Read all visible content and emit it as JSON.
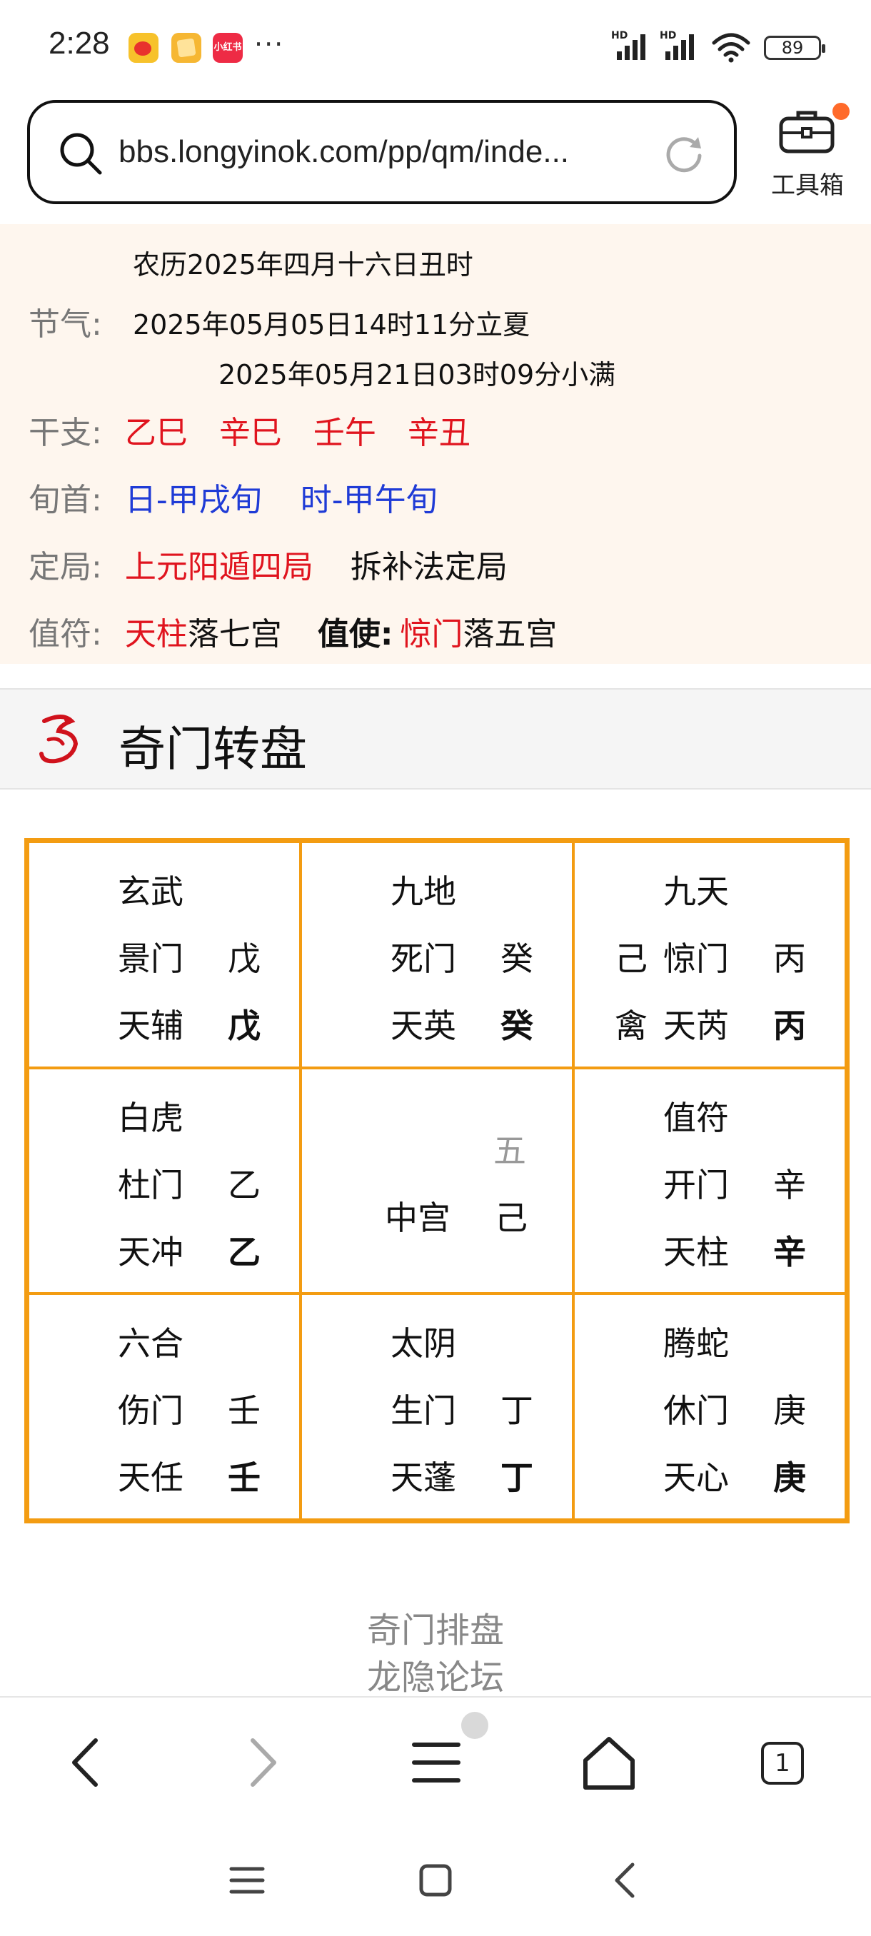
{
  "status_bar": {
    "time": "2:28",
    "xhs_badge": "小红书",
    "more": "···",
    "hd1": "HD",
    "hd2": "HD",
    "battery": "89"
  },
  "address_bar": {
    "url": "bbs.longyinok.com/pp/qm/inde..."
  },
  "toolbox": {
    "label": "工具箱"
  },
  "info": {
    "lunar": "农历2025年四月十六日丑时",
    "jieqi_label": "节气:",
    "jieqi_1": "2025年05月05日14时11分立夏",
    "jieqi_2": "2025年05月21日03时09分小满",
    "ganzhi_label": "干支:",
    "ganzhi": [
      "乙巳",
      "辛巳",
      "壬午",
      "辛丑"
    ],
    "xunshou_label": "旬首:",
    "xunshou": [
      "日-甲戌旬",
      "时-甲午旬"
    ],
    "dingju_label": "定局:",
    "dingju_value": "上元阳遁四局",
    "dingju_method": "拆补法定局",
    "zhifu_label": "值符:",
    "zhifu_star": "天柱",
    "zhifu_palace": "落七宫",
    "zhishi_label": "值使:",
    "zhishi_door": "惊门",
    "zhishi_palace": "落五宫"
  },
  "section": {
    "title": "奇门转盘"
  },
  "chart": {
    "cells": [
      {
        "god": "玄武",
        "door": "景门",
        "door_stem": "戊",
        "star": "天辅",
        "star_stem": "戊"
      },
      {
        "god": "九地",
        "door": "死门",
        "door_stem": "癸",
        "star": "天英",
        "star_stem": "癸"
      },
      {
        "god": "九天",
        "side_1": "己",
        "side_2": "禽",
        "door": "惊门",
        "door_stem": "丙",
        "star": "天芮",
        "star_stem": "丙"
      },
      {
        "god": "白虎",
        "door": "杜门",
        "door_stem": "乙",
        "star": "天冲",
        "star_stem": "乙"
      },
      {
        "center_number": "五",
        "center_label": "中宫",
        "center_stem": "己"
      },
      {
        "god": "值符",
        "door": "开门",
        "door_stem": "辛",
        "star": "天柱",
        "star_stem": "辛"
      },
      {
        "god": "六合",
        "door": "伤门",
        "door_stem": "壬",
        "star": "天任",
        "star_stem": "壬"
      },
      {
        "god": "太阴",
        "door": "生门",
        "door_stem": "丁",
        "star": "天蓬",
        "star_stem": "丁"
      },
      {
        "god": "腾蛇",
        "door": "休门",
        "door_stem": "庚",
        "star": "天心",
        "star_stem": "庚"
      }
    ]
  },
  "footer": {
    "line1": "奇门排盘",
    "line2": "龙隐论坛"
  },
  "browser_toolbar": {
    "tab_count": "1"
  },
  "colors": {
    "accent_orange": "#f39c12",
    "red_text": "#e0141e",
    "blue_text": "#1f3bd6",
    "panel_bg": "#fef6ee"
  }
}
